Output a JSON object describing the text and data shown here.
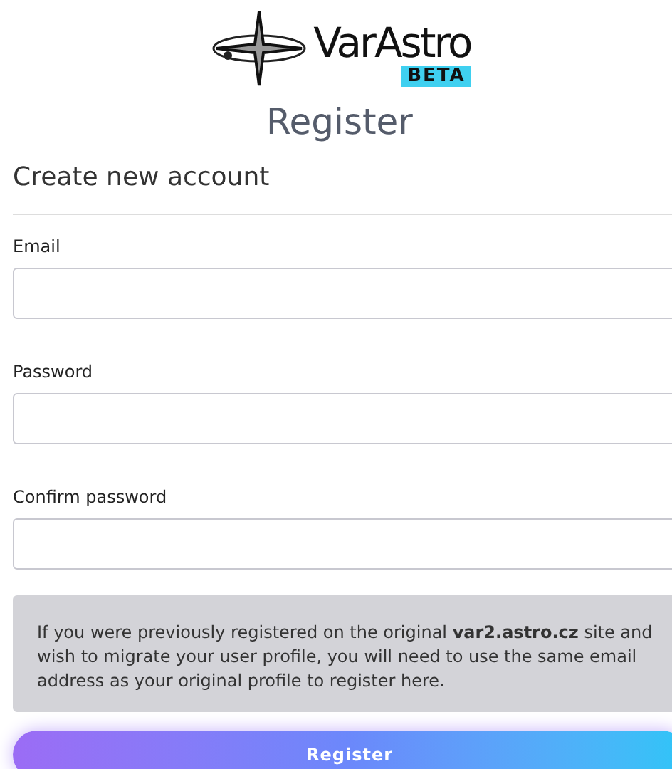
{
  "logo": {
    "name": "VarAstro",
    "badge": "BETA"
  },
  "title": "Register",
  "subtitle": "Create new account",
  "fields": [
    {
      "label": "Email"
    },
    {
      "label": "Password"
    },
    {
      "label": "Confirm password"
    }
  ],
  "notice": "If you were previously registered on the original **var2.astro.cz** site and wish to migrate your user profile, you will need to use the same email address as your original profile to register here.",
  "submit": "Register"
}
